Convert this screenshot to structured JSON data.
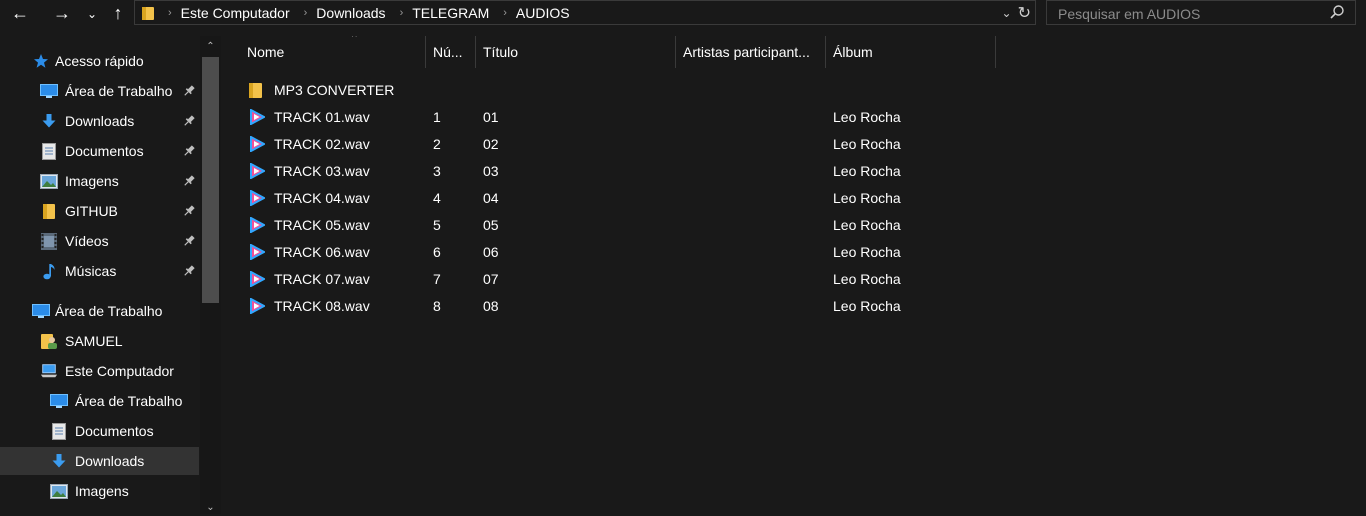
{
  "window": {
    "breadcrumb": [
      "Este Computador",
      "Downloads",
      "TELEGRAM",
      "AUDIOS"
    ]
  },
  "search": {
    "placeholder": "Pesquisar em AUDIOS"
  },
  "icons": {
    "back": "←",
    "forward": "→",
    "recent": "⌄",
    "up": "↑",
    "address_dropdown": "⌄",
    "refresh": "↻",
    "separator": "›",
    "scroll_up": "⌃",
    "scroll_down": "⌄",
    "sort": "^"
  },
  "colors": {
    "background": "#191919",
    "selected": "#333333",
    "folder": "#f3c24a",
    "accent_blue": "#2b8ce8",
    "play_blue": "#31a7ff",
    "play_pink": "#f0509a"
  },
  "sidebar": {
    "items": [
      {
        "label": "Acesso rápido",
        "icon": "star-icon",
        "indent": 0,
        "pinned": false,
        "selected": false
      },
      {
        "label": "Área de Trabalho",
        "icon": "desktop-icon",
        "indent": 1,
        "pinned": true,
        "selected": false
      },
      {
        "label": "Downloads",
        "icon": "download-icon",
        "indent": 1,
        "pinned": true,
        "selected": false
      },
      {
        "label": "Documentos",
        "icon": "document-icon",
        "indent": 1,
        "pinned": true,
        "selected": false
      },
      {
        "label": "Imagens",
        "icon": "image-icon",
        "indent": 1,
        "pinned": true,
        "selected": false
      },
      {
        "label": "GITHUB",
        "icon": "folder-icon",
        "indent": 1,
        "pinned": true,
        "selected": false
      },
      {
        "label": "Vídeos",
        "icon": "video-icon",
        "indent": 1,
        "pinned": true,
        "selected": false
      },
      {
        "label": "Músicas",
        "icon": "music-icon",
        "indent": 1,
        "pinned": true,
        "selected": false
      },
      {
        "label": "Área de Trabalho",
        "icon": "desktop-icon",
        "indent": 0,
        "pinned": false,
        "selected": false,
        "gap_before": true
      },
      {
        "label": "SAMUEL",
        "icon": "user-folder-icon",
        "indent": 1,
        "pinned": false,
        "selected": false
      },
      {
        "label": "Este Computador",
        "icon": "computer-icon",
        "indent": 1,
        "pinned": false,
        "selected": false
      },
      {
        "label": "Área de Trabalho",
        "icon": "desktop-icon",
        "indent": 2,
        "pinned": false,
        "selected": false
      },
      {
        "label": "Documentos",
        "icon": "document-icon",
        "indent": 2,
        "pinned": false,
        "selected": false
      },
      {
        "label": "Downloads",
        "icon": "download-icon",
        "indent": 2,
        "pinned": false,
        "selected": true
      },
      {
        "label": "Imagens",
        "icon": "image-icon",
        "indent": 2,
        "pinned": false,
        "selected": false
      }
    ]
  },
  "columns": [
    {
      "key": "name",
      "label": "Nome"
    },
    {
      "key": "number",
      "label": "Nú..."
    },
    {
      "key": "title",
      "label": "Título"
    },
    {
      "key": "artists",
      "label": "Artistas participant..."
    },
    {
      "key": "album",
      "label": "Álbum"
    }
  ],
  "files": [
    {
      "type": "folder",
      "name": "MP3 CONVERTER",
      "number": "",
      "title": "",
      "artists": "",
      "album": ""
    },
    {
      "type": "audio",
      "name": "TRACK 01.wav",
      "number": "1",
      "title": "01",
      "artists": "",
      "album": "Leo Rocha"
    },
    {
      "type": "audio",
      "name": "TRACK 02.wav",
      "number": "2",
      "title": "02",
      "artists": "",
      "album": "Leo Rocha"
    },
    {
      "type": "audio",
      "name": "TRACK 03.wav",
      "number": "3",
      "title": "03",
      "artists": "",
      "album": "Leo Rocha"
    },
    {
      "type": "audio",
      "name": "TRACK 04.wav",
      "number": "4",
      "title": "04",
      "artists": "",
      "album": "Leo Rocha"
    },
    {
      "type": "audio",
      "name": "TRACK 05.wav",
      "number": "5",
      "title": "05",
      "artists": "",
      "album": "Leo Rocha"
    },
    {
      "type": "audio",
      "name": "TRACK 06.wav",
      "number": "6",
      "title": "06",
      "artists": "",
      "album": "Leo Rocha"
    },
    {
      "type": "audio",
      "name": "TRACK 07.wav",
      "number": "7",
      "title": "07",
      "artists": "",
      "album": "Leo Rocha"
    },
    {
      "type": "audio",
      "name": "TRACK 08.wav",
      "number": "8",
      "title": "08",
      "artists": "",
      "album": "Leo Rocha"
    }
  ]
}
